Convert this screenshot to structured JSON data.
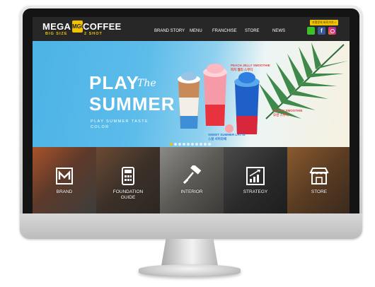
{
  "logo": {
    "word_left": "MEGA",
    "badge": "MGC",
    "word_right": "COFFEE",
    "sub_left": "BIG SIZE",
    "sub_right": "2 SHOT"
  },
  "nav": {
    "items": [
      {
        "label": "BRAND STORY"
      },
      {
        "label": "MENU"
      },
      {
        "label": "FRANCHISE"
      },
      {
        "label": "STORE"
      },
      {
        "label": "NEWS"
      }
    ]
  },
  "header_button": "가맹문의 바로가기 >",
  "social": [
    {
      "icon": "kakaotalk-icon",
      "color": "#3cc12a"
    },
    {
      "icon": "facebook-icon",
      "glyph": "f",
      "color": "#3b5998"
    },
    {
      "icon": "instagram-icon",
      "color": "#dd2a7b"
    }
  ],
  "hero": {
    "title_line1": "PLAY",
    "script_word": "The",
    "title_line2": "SUMMER",
    "tagline": "PLAY SUMMER TASTE COLOR",
    "drinks": [
      {
        "name_en": "PEACH JELLY SMOOTHIE",
        "name_ko": "피치 젤리 스무디"
      },
      {
        "name_en": "OCEAN SMOOTHIE",
        "name_ko": "오션 스무디"
      },
      {
        "name_en": "SWEET SUMMER LATTE",
        "name_ko": "스윗 서머라떼"
      }
    ],
    "slide_count": 10,
    "active_slide": 1
  },
  "tiles": [
    {
      "label": "BRAND",
      "icon": "brand-logo-icon"
    },
    {
      "label": "FOUNDATION\nGUIDE",
      "icon": "calculator-icon"
    },
    {
      "label": "INTERIOR",
      "icon": "paint-roller-icon"
    },
    {
      "label": "STRATEGY",
      "icon": "chart-growth-icon"
    },
    {
      "label": "STORE",
      "icon": "storefront-icon"
    }
  ],
  "colors": {
    "brand_yellow": "#f2c200",
    "header_bg": "#272727",
    "hero_sky": "#4cb3e6"
  }
}
